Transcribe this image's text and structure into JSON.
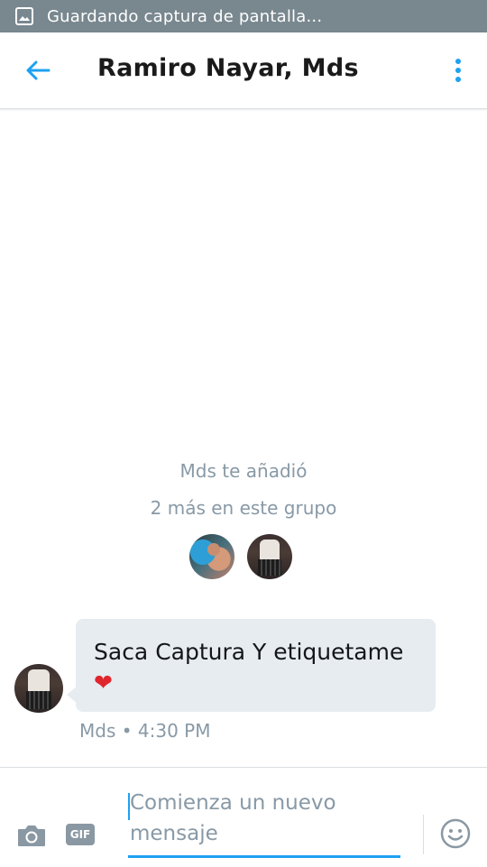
{
  "status_bar": {
    "icon": "image-icon",
    "text": "Guardando captura de pantalla..."
  },
  "header": {
    "back_icon": "arrow-left-icon",
    "title": "Ramiro Nayar, Mds",
    "menu_icon": "more-vertical-icon"
  },
  "conversation": {
    "system_added": "Mds te añadió",
    "system_more": "2 más en este grupo",
    "members": [
      {
        "avatar": "member-avatar-1"
      },
      {
        "avatar": "member-avatar-2"
      }
    ],
    "messages": [
      {
        "text": "Saca Captura Y etiquetame",
        "emoji": "❤",
        "sender": "Mds",
        "time": "4:30 PM",
        "meta": "Mds • 4:30 PM"
      }
    ]
  },
  "composer": {
    "camera_icon": "camera-icon",
    "gif_label": "GIF",
    "placeholder": "Comienza un nuevo mensaje",
    "emoji_icon": "smiley-icon"
  },
  "colors": {
    "accent": "#1da1f2",
    "status_bar": "#79878f",
    "bubble": "#e6ecf0",
    "muted_text": "#8899a6"
  }
}
